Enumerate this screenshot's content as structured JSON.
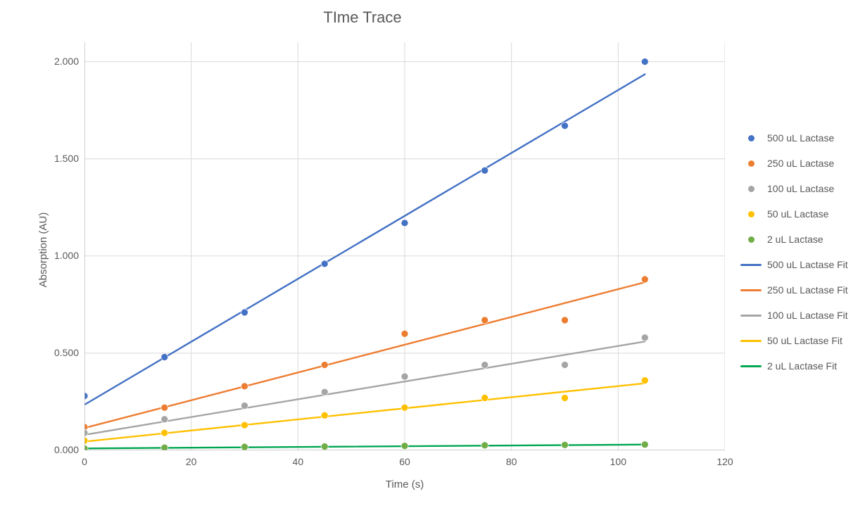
{
  "chart_data": {
    "type": "scatter",
    "title": "TIme Trace",
    "xlabel": "Time (s)",
    "ylabel": "Absorption (AU)",
    "xlim": [
      0,
      120
    ],
    "ylim": [
      0,
      2.1
    ],
    "xticks": [
      0,
      20,
      40,
      60,
      80,
      100,
      120
    ],
    "yticks": [
      0.0,
      0.5,
      1.0,
      1.5,
      2.0
    ],
    "ytick_labels": [
      "0.000",
      "0.500",
      "1.000",
      "1.500",
      "2.000"
    ],
    "x": [
      0,
      15,
      30,
      45,
      60,
      75,
      90,
      105
    ],
    "series": [
      {
        "name": "500 uL Lactase",
        "color": "#4472C4",
        "kind": "points",
        "y": [
          0.28,
          0.48,
          0.71,
          0.96,
          1.17,
          1.44,
          1.67,
          2.0
        ]
      },
      {
        "name": "250 uL Lactase",
        "color": "#ED7D31",
        "kind": "points",
        "y": [
          0.12,
          0.22,
          0.33,
          0.44,
          0.6,
          0.67,
          0.67,
          0.88
        ]
      },
      {
        "name": "100 uL Lactase",
        "color": "#A5A5A5",
        "kind": "points",
        "y": [
          0.09,
          0.16,
          0.23,
          0.3,
          0.38,
          0.44,
          0.44,
          0.58
        ]
      },
      {
        "name": "50 uL Lactase",
        "color": "#FFC000",
        "kind": "points",
        "y": [
          0.05,
          0.09,
          0.13,
          0.18,
          0.22,
          0.27,
          0.27,
          0.36
        ]
      },
      {
        "name": "2 uL Lactase",
        "color": "#70AD47",
        "kind": "points",
        "y": [
          0.01,
          0.014,
          0.018,
          0.02,
          0.023,
          0.026,
          0.028,
          0.03
        ]
      },
      {
        "name": "500 uL Lactase Fit",
        "color": "#4472C4",
        "kind": "line",
        "fit": {
          "x0": 0,
          "y0": 0.235,
          "x1": 105,
          "y1": 1.935
        }
      },
      {
        "name": "250 uL Lactase Fit",
        "color": "#ED7D31",
        "kind": "line",
        "fit": {
          "x0": 0,
          "y0": 0.115,
          "x1": 105,
          "y1": 0.865
        }
      },
      {
        "name": "100 uL Lactase Fit",
        "color": "#A5A5A5",
        "kind": "line",
        "fit": {
          "x0": 0,
          "y0": 0.08,
          "x1": 105,
          "y1": 0.56
        }
      },
      {
        "name": "50 uL Lactase Fit",
        "color": "#FFC000",
        "kind": "line",
        "fit": {
          "x0": 0,
          "y0": 0.045,
          "x1": 105,
          "y1": 0.345
        }
      },
      {
        "name": "2 uL Lactase Fit",
        "color": "#00A651",
        "kind": "line",
        "fit": {
          "x0": 0,
          "y0": 0.01,
          "x1": 105,
          "y1": 0.03
        }
      }
    ]
  }
}
